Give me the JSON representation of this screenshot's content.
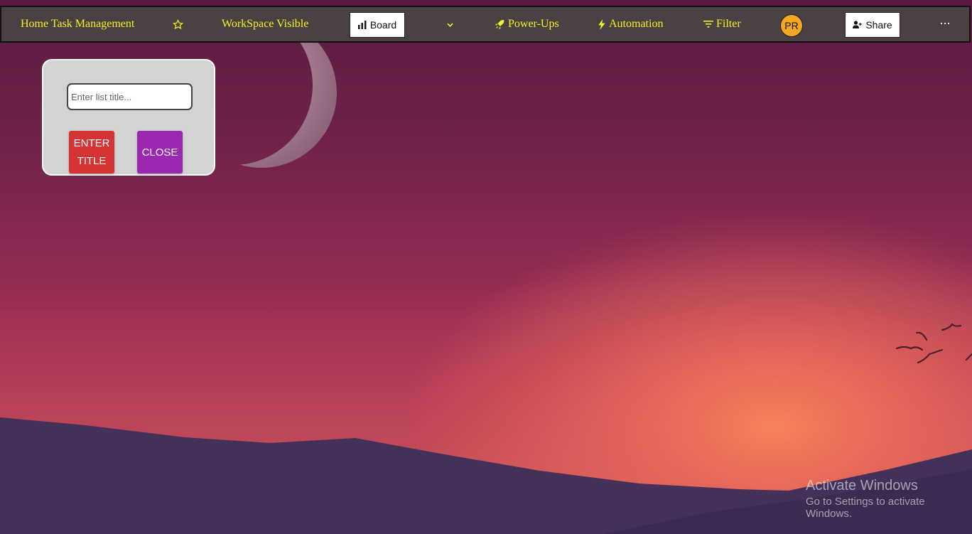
{
  "topbar": {
    "board_title": "Home Task Management",
    "star_icon": "star-outline-icon",
    "workspace_label": "WorkSpace Visible",
    "board_button": "Board",
    "board_icon": "bar-chart-icon",
    "dropdown_icon": "chevron-down-icon",
    "powerups_label": "Power-Ups",
    "powerups_icon": "rocket-icon",
    "automation_label": "Automation",
    "automation_icon": "lightning-icon",
    "filter_label": "Filter",
    "filter_icon": "filter-icon",
    "avatar_initials": "PR",
    "share_button": "Share",
    "share_icon": "add-user-icon",
    "more_label": "···",
    "text_color": "#f2f02a",
    "bar_color": "#4a4242"
  },
  "add_list": {
    "placeholder": "Enter list title...",
    "value": "",
    "enter_label_line1": "ENTER",
    "enter_label_line2": "TITLE",
    "enter_color": "#d63434",
    "close_label": "CLOSE",
    "close_color": "#9c27b0"
  },
  "watermark": {
    "line1": "Activate Windows",
    "line2": "Go to Settings to activate Windows."
  }
}
